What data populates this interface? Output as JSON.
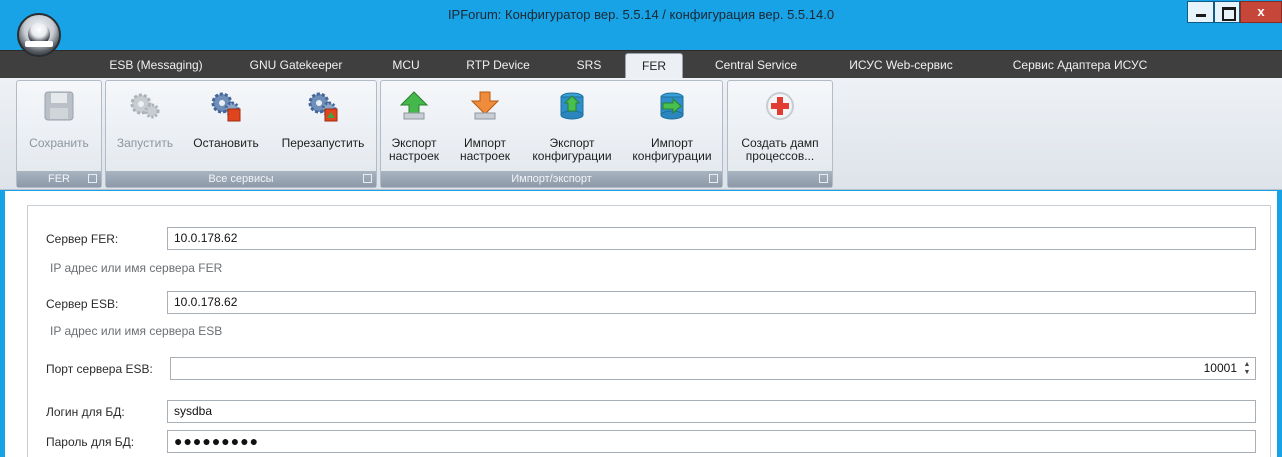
{
  "window": {
    "title": "IPForum: Конфигуратор вер. 5.5.14 / конфигурация вер. 5.5.14.0",
    "close_label": "x"
  },
  "tabs": [
    {
      "label": "ESB (Messaging)"
    },
    {
      "label": "GNU Gatekeeper"
    },
    {
      "label": "MCU"
    },
    {
      "label": "RTP Device"
    },
    {
      "label": "SRS"
    },
    {
      "label": "FER",
      "active": true
    },
    {
      "label": "Central Service"
    },
    {
      "label": "ИСУС Web-сервис"
    },
    {
      "label": "Сервис Адаптера ИСУС"
    }
  ],
  "ribbon": {
    "groups": {
      "fer": {
        "caption": "FER"
      },
      "all_services": {
        "caption": "Все сервисы"
      },
      "import_export": {
        "caption": "Импорт/экспорт"
      },
      "dump": {
        "caption": ""
      }
    },
    "buttons": {
      "save": {
        "label": "Сохранить",
        "icon": "floppy-disk-icon",
        "enabled": false
      },
      "start": {
        "label": "Запустить",
        "icon": "gears-start-icon",
        "enabled": false
      },
      "stop": {
        "label": "Остановить",
        "icon": "gears-stop-icon",
        "enabled": true
      },
      "restart": {
        "label": "Перезапустить",
        "icon": "gears-restart-icon",
        "enabled": true
      },
      "export_settings": {
        "line1": "Экспорт",
        "line2": "настроек",
        "icon": "export-arrow-icon"
      },
      "import_settings": {
        "line1": "Импорт",
        "line2": "настроек",
        "icon": "import-arrow-icon"
      },
      "export_config": {
        "line1": "Экспорт",
        "line2": "конфигурации",
        "icon": "export-db-icon"
      },
      "import_config": {
        "line1": "Импорт",
        "line2": "конфигурации",
        "icon": "import-db-icon"
      },
      "create_dump": {
        "line1": "Создать дамп",
        "line2": "процессов...",
        "icon": "medical-cross-icon"
      }
    }
  },
  "form": {
    "fer_server": {
      "label": "Сервер FER:",
      "value": "10.0.178.62",
      "hint": "IP адрес или имя сервера FER"
    },
    "esb_server": {
      "label": "Сервер ESB:",
      "value": "10.0.178.62",
      "hint": "IP адрес или имя сервера ESB"
    },
    "esb_port": {
      "label": "Порт сервера ESB:",
      "value": "10001"
    },
    "db_login": {
      "label": "Логин для БД:",
      "value": "sysdba"
    },
    "db_password": {
      "label": "Пароль для БД:",
      "value": "●●●●●●●●●"
    }
  },
  "colors": {
    "window_frame": "#17a3e6",
    "tabs_bar": "#3f3f3f",
    "ribbon_caption": "#8d99a8"
  }
}
